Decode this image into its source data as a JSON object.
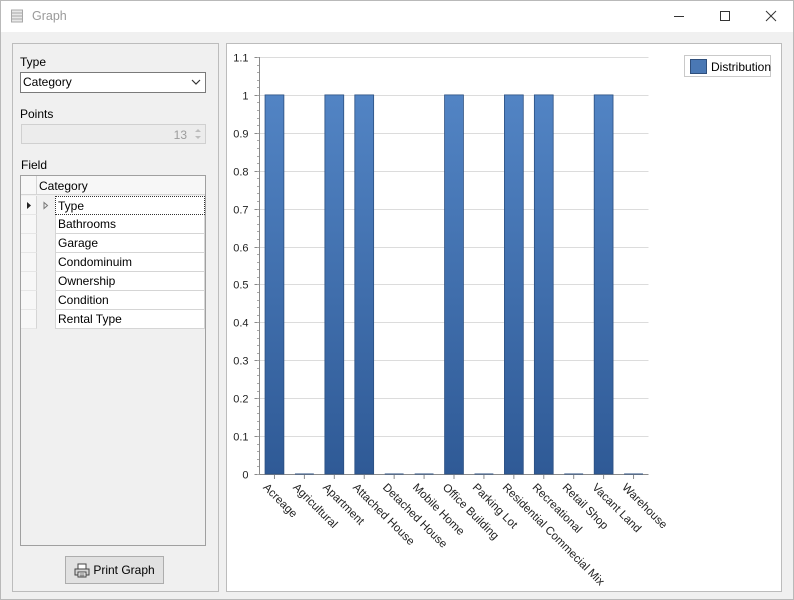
{
  "window": {
    "title": "Graph"
  },
  "left_panel": {
    "type_label": "Type",
    "type_value": "Category",
    "points_label": "Points",
    "points_value": "13",
    "field_label": "Field",
    "grid_header": "Category",
    "fields": [
      "Type",
      "Bathrooms",
      "Garage",
      "Condominuim",
      "Ownership",
      "Condition",
      "Rental Type"
    ],
    "print_label": "Print Graph"
  },
  "colors": {
    "bar_top": "#5284c4",
    "bar_bottom": "#2f5a96",
    "bar_border": "#2b4f80"
  },
  "chart_data": {
    "type": "bar",
    "categories": [
      "Acreage",
      "Agricultural",
      "Apartment",
      "Attached House",
      "Detached House",
      "Mobile Home",
      "Office Building",
      "Parking Lot",
      "Residential Commecial Mix",
      "Recreational",
      "Retail Shop",
      "Vacant Land",
      "Warehouse"
    ],
    "series": [
      {
        "name": "Distribution",
        "values": [
          1,
          0,
          1,
          1,
          0,
          0,
          1,
          0,
          1,
          1,
          0,
          1,
          0
        ]
      }
    ],
    "y_ticks": [
      "0",
      "0.1",
      "0.2",
      "0.3",
      "0.4",
      "0.5",
      "0.6",
      "0.7",
      "0.8",
      "0.9",
      "1",
      "1.1"
    ],
    "ylim": [
      0,
      1.1
    ],
    "grid": true,
    "legend_position": "top-right"
  }
}
